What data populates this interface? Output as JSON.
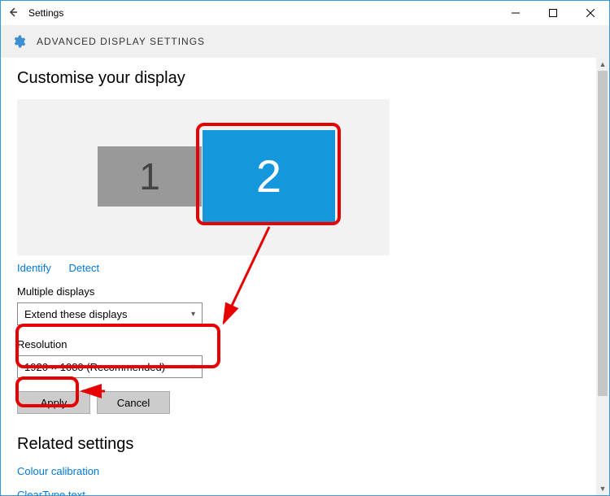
{
  "window": {
    "title": "Settings"
  },
  "header": {
    "page_title": "ADVANCED DISPLAY SETTINGS"
  },
  "section_title": "Customise your display",
  "monitors": {
    "m1": "1",
    "m2": "2"
  },
  "links": {
    "identify": "Identify",
    "detect": "Detect"
  },
  "multiple_displays": {
    "label": "Multiple displays",
    "value": "Extend these displays"
  },
  "resolution": {
    "label": "Resolution",
    "value": "1920 × 1080 (Recommended)"
  },
  "buttons": {
    "apply": "Apply",
    "cancel": "Cancel"
  },
  "related": {
    "heading": "Related settings",
    "colour_calibration": "Colour calibration",
    "cleartype": "ClearType text"
  }
}
